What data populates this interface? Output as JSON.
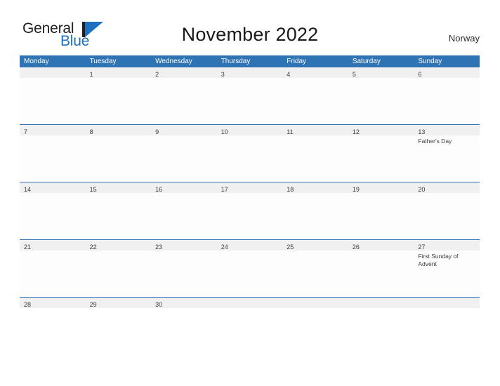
{
  "brand": {
    "name_part1": "General",
    "name_part2": "Blue",
    "logo_icon": "triangle-flag-icon"
  },
  "header": {
    "title": "November 2022",
    "country": "Norway"
  },
  "colors": {
    "header_blue": "#2e74b5",
    "logo_blue": "#1f6fc0",
    "day_band_gray": "#f0f0f0",
    "cell_background": "#fdfdfd",
    "text_dark": "#3c3c3c"
  },
  "calendar": {
    "weekday_headers": [
      "Monday",
      "Tuesday",
      "Wednesday",
      "Thursday",
      "Friday",
      "Saturday",
      "Sunday"
    ],
    "weeks": [
      {
        "short": false,
        "days": [
          {
            "date": "",
            "events": []
          },
          {
            "date": "1",
            "events": []
          },
          {
            "date": "2",
            "events": []
          },
          {
            "date": "3",
            "events": []
          },
          {
            "date": "4",
            "events": []
          },
          {
            "date": "5",
            "events": []
          },
          {
            "date": "6",
            "events": []
          }
        ]
      },
      {
        "short": false,
        "days": [
          {
            "date": "7",
            "events": []
          },
          {
            "date": "8",
            "events": []
          },
          {
            "date": "9",
            "events": []
          },
          {
            "date": "10",
            "events": []
          },
          {
            "date": "11",
            "events": []
          },
          {
            "date": "12",
            "events": []
          },
          {
            "date": "13",
            "events": [
              "Father's Day"
            ]
          }
        ]
      },
      {
        "short": false,
        "days": [
          {
            "date": "14",
            "events": []
          },
          {
            "date": "15",
            "events": []
          },
          {
            "date": "16",
            "events": []
          },
          {
            "date": "17",
            "events": []
          },
          {
            "date": "18",
            "events": []
          },
          {
            "date": "19",
            "events": []
          },
          {
            "date": "20",
            "events": []
          }
        ]
      },
      {
        "short": false,
        "days": [
          {
            "date": "21",
            "events": []
          },
          {
            "date": "22",
            "events": []
          },
          {
            "date": "23",
            "events": []
          },
          {
            "date": "24",
            "events": []
          },
          {
            "date": "25",
            "events": []
          },
          {
            "date": "26",
            "events": []
          },
          {
            "date": "27",
            "events": [
              "First Sunday of Advent"
            ]
          }
        ]
      },
      {
        "short": true,
        "days": [
          {
            "date": "28",
            "events": []
          },
          {
            "date": "29",
            "events": []
          },
          {
            "date": "30",
            "events": []
          },
          {
            "date": "",
            "events": []
          },
          {
            "date": "",
            "events": []
          },
          {
            "date": "",
            "events": []
          },
          {
            "date": "",
            "events": []
          }
        ]
      }
    ]
  }
}
